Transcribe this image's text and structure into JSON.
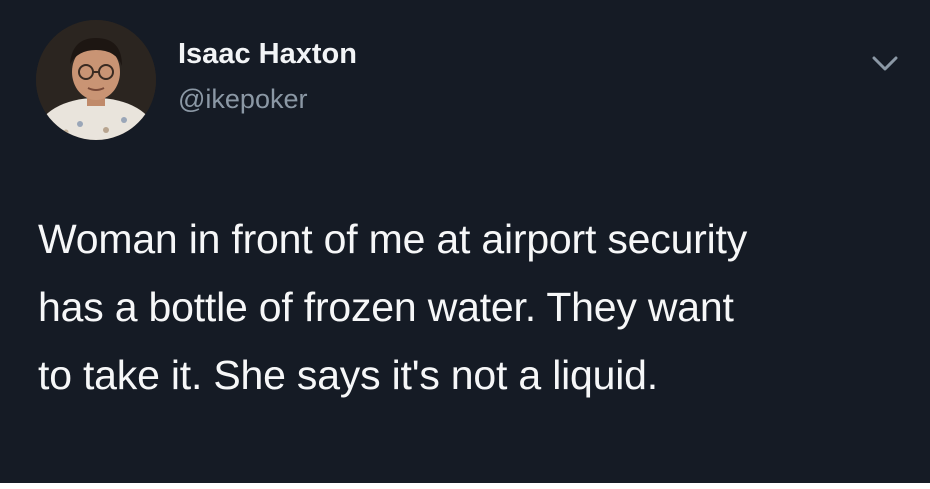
{
  "tweet": {
    "author": {
      "display_name": "Isaac Haxton",
      "handle": "@ikepoker"
    },
    "menu_icon": "chevron-down-icon",
    "text_lines": [
      "Woman in front of me at airport security",
      "has a bottle of frozen water. They want",
      "to take it. She says it's not a liquid."
    ]
  },
  "colors": {
    "background": "#151b25",
    "name": "#f2f4f6",
    "handle": "#8b98a5",
    "text": "#f6f7f8"
  }
}
